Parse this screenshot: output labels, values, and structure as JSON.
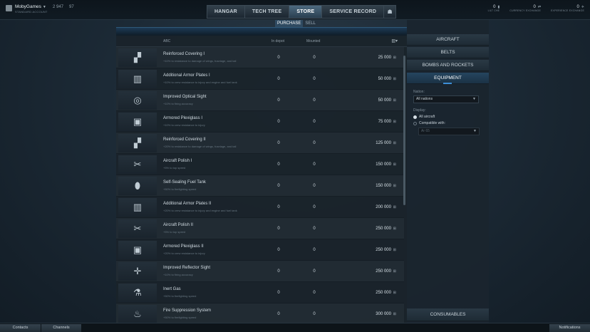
{
  "player": {
    "name": "MobyGames",
    "account_type": "STANDARD ACCOUNT",
    "currency_1": "2 947",
    "currency_2": "97"
  },
  "nav": {
    "tabs": [
      "HANGAR",
      "TECH TREE",
      "STORE",
      "SERVICE RECORD"
    ],
    "active": "STORE",
    "icon": "settings-icon"
  },
  "stats": [
    {
      "value": "0",
      "label": "LILT CHE",
      "icon": "ammo-icon"
    },
    {
      "value": "0",
      "label": "CURRENCY EXCHANGE",
      "icon": "exchange-icon"
    },
    {
      "value": "0",
      "label": "EXPERIENCE EXCHANGE",
      "icon": "plane-icon"
    }
  ],
  "store_tabs": {
    "purchase": "PURCHASE",
    "sell": "SELL",
    "active": "PURCHASE"
  },
  "table": {
    "headers": {
      "name": "ABC",
      "depot": "In depot",
      "mounted": "Mounted"
    },
    "currency_symbol": "⊞",
    "rows": [
      {
        "icon": "wing-covering-icon",
        "name": "Reinforced Covering I",
        "desc": "+10% to resistance to damage of wings, fuselage, and tail",
        "depot": "0",
        "mounted": "0",
        "price": "25 000"
      },
      {
        "icon": "armor-plate-icon",
        "name": "Additional Armor Plates I",
        "desc": "+10% to crew resistance to injury and engine and fuel tank",
        "depot": "0",
        "mounted": "0",
        "price": "50 000"
      },
      {
        "icon": "optical-sight-icon",
        "name": "Improved Optical Sight",
        "desc": "+10% to firing accuracy",
        "depot": "0",
        "mounted": "0",
        "price": "50 000"
      },
      {
        "icon": "plexiglass-icon",
        "name": "Armored Plexiglass I",
        "desc": "+10% to crew resistance to injury",
        "depot": "0",
        "mounted": "0",
        "price": "75 000"
      },
      {
        "icon": "wing-covering-icon",
        "name": "Reinforced Covering II",
        "desc": "+20% to resistance to damage of wings, fuselage, and tail",
        "depot": "0",
        "mounted": "0",
        "price": "125 000"
      },
      {
        "icon": "polish-icon",
        "name": "Aircraft Polish I",
        "desc": "+5% to top speed",
        "depot": "0",
        "mounted": "0",
        "price": "150 000"
      },
      {
        "icon": "fuel-tank-icon",
        "name": "Self-Sealing Fuel Tank",
        "desc": "+50% to firefighting speed",
        "depot": "0",
        "mounted": "0",
        "price": "150 000"
      },
      {
        "icon": "armor-plate-icon",
        "name": "Additional Armor Plates II",
        "desc": "+20% to crew resistance to injury and engine and fuel tank",
        "depot": "0",
        "mounted": "0",
        "price": "200 000"
      },
      {
        "icon": "polish-icon",
        "name": "Aircraft Polish II",
        "desc": "+5% to top speed",
        "depot": "0",
        "mounted": "0",
        "price": "250 000"
      },
      {
        "icon": "plexiglass-icon",
        "name": "Armored Plexiglass II",
        "desc": "+20% to crew resistance to injury",
        "depot": "0",
        "mounted": "0",
        "price": "250 000"
      },
      {
        "icon": "reflector-sight-icon",
        "name": "Improved Reflector Sight",
        "desc": "+10% to firing accuracy",
        "depot": "0",
        "mounted": "0",
        "price": "250 000"
      },
      {
        "icon": "gas-cylinder-icon",
        "name": "Inert Gas",
        "desc": "+50% to firefighting speed",
        "depot": "0",
        "mounted": "0",
        "price": "250 000"
      },
      {
        "icon": "extinguisher-icon",
        "name": "Fire Suppression System",
        "desc": "+50% to firefighting speed",
        "depot": "0",
        "mounted": "0",
        "price": "300 000"
      }
    ]
  },
  "sidebar": {
    "categories": [
      "AIRCRAFT",
      "BELTS",
      "BOMBS AND ROCKETS",
      "EQUIPMENT"
    ],
    "active": "EQUIPMENT",
    "nation_label": "Nation:",
    "nation_value": "All nations",
    "display_label": "Display:",
    "option_all": "All aircraft",
    "option_compatible": "Compatible with:",
    "compatible_value": "Ar 65",
    "bottom": "CONSUMABLES"
  },
  "bottom": {
    "contacts": "Contacts",
    "channels": "Channels",
    "notifications": "Notifications"
  }
}
